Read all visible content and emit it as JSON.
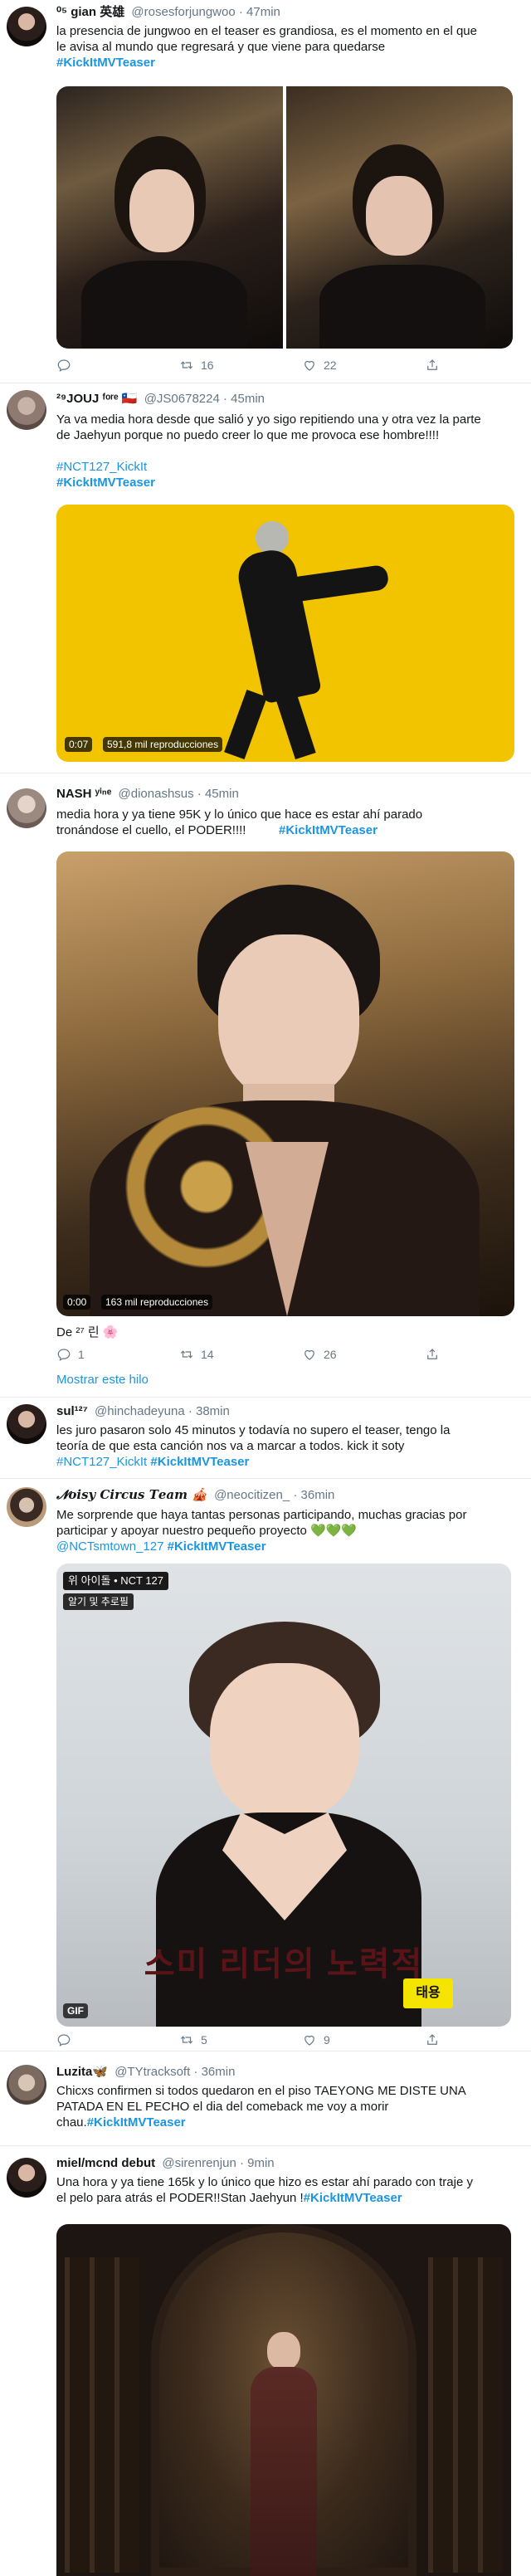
{
  "tweets": [
    {
      "name": "⁰⁵ gian 英雄",
      "handle": "@rosesforjungwoo · 47min",
      "lines": [
        "la presencia de jungwoo en el teaser es grandiosa, es el momento en el que",
        "le avisa al mundo que regresará y que viene para quedarse"
      ],
      "hashtag": "#KickItMVTeaser",
      "replies": "",
      "retweets": "16",
      "likes": "22"
    },
    {
      "name": "²⁹JOUJ ᶠᵒʳᵉ 🇨🇱",
      "handle": "@JS0678224 · 45min",
      "lines": [
        "Ya va media hora desde que salió y yo sigo repitiendo una y otra vez la parte",
        "de Jaehyun  porque no puedo creer lo que me provoca ese hombre!!!!"
      ],
      "hashtags": [
        "#NCT127_KickIt",
        "#KickItMVTeaser"
      ],
      "video_time": "0:07",
      "video_views": "591,8 mil reproducciones"
    },
    {
      "name": "NASH ʸⁱⁿᵉ",
      "handle": "@dionashsus · 45min",
      "lines": [
        "media hora y ya tiene 95K y lo único que hace es estar ahí parado",
        "tronándose el cuello, el PODER!!!!"
      ],
      "hashtag": "#KickItMVTeaser",
      "video_time": "0:00",
      "video_views": "163 mil reproducciones",
      "reply_to": "De ²⁷ 린 🌸",
      "replies": "1",
      "retweets": "14",
      "likes": "26",
      "show_thread": "Mostrar este hilo"
    },
    {
      "name": "sul¹²⁷",
      "handle": "@hinchadeyuna · 38min",
      "lines": [
        "les juro pasaron solo 45 minutos y todavía no supero el teaser, tengo la",
        "teoría de que esta canción nos va a marcar a todos. kick it soty"
      ],
      "hashtags": [
        "#NCT127_KickIt",
        "#KickItMVTeaser"
      ]
    },
    {
      "name": "𝓝𝒐𝒊𝒔𝒚 𝑪𝒊𝒓𝒄𝒖𝒔 𝑻𝒆𝒂𝒎 🎪",
      "handle": "@neocitizen_ · 36min",
      "lines": [
        "Me sorprende que haya tantas personas participando, muchas gracias por",
        "participar y apoyar nuestro pequeño proyecto 💚💚💚"
      ],
      "mention": "@NCTsmtown_127",
      "hashtag": "#KickItMVTeaser",
      "gif_label": "GIF",
      "gif_caption_top": "위 아이돌 • NCT 127",
      "gif_caption_top2": "알기 및 추로필",
      "gif_caption_bottom": "스미 리더의 노력적",
      "gif_tag": "태용",
      "retweets": "5",
      "likes": "9"
    },
    {
      "name": "Luzita🦋",
      "handle": "@TYtracksoft · 36min",
      "lines": [
        "Chicxs confirmen si todos quedaron en el piso TAEYONG ME DISTE UNA",
        "PATADA EN EL PECHO el dia del comeback me voy a morir"
      ],
      "tail": "chau.",
      "hashtag": "#KickItMVTeaser"
    },
    {
      "name": "miel/mcnd debut",
      "handle": "@sirenrenjun · 9min",
      "lines": [
        "Una hora y ya tiene 165k y lo único que hizo es estar ahí parado con traje y",
        "el pelo para atrás  el PODER!!Stan Jaehyun !"
      ],
      "hashtag": "#KickItMVTeaser"
    }
  ],
  "colors": {
    "link": "#1b95e0",
    "secondary": "#657786",
    "text": "#14171a",
    "border": "#e6ecf0",
    "heart": "#e0245e"
  },
  "icons": [
    "reply-icon",
    "retweet-icon",
    "like-icon",
    "share-icon",
    "play-icon"
  ]
}
